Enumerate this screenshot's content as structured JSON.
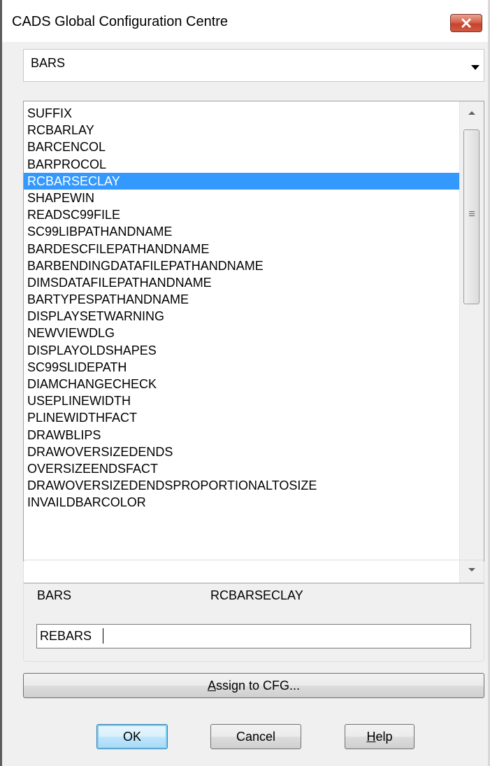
{
  "window": {
    "title": "CADS Global Configuration Centre"
  },
  "combo": {
    "value": "BARS"
  },
  "list": {
    "items": [
      "SUFFIX",
      "RCBARLAY",
      "BARCENCOL",
      "BARPROCOL",
      "RCBARSECLAY",
      "SHAPEWIN",
      "READSC99FILE",
      "SC99LIBPATHANDNAME",
      "BARDESCFILEPATHANDNAME",
      "BARBENDINGDATAFILEPATHANDNAME",
      "DIMSDATAFILEPATHANDNAME",
      "BARTYPESPATHANDNAME",
      "DISPLAYSETWARNING",
      "NEWVIEWDLG",
      "DISPLAYOLDSHAPES",
      "SC99SLIDEPATH",
      "DIAMCHANGECHECK",
      "USEPLINEWIDTH",
      "PLINEWIDTHFACT",
      "DRAWBLIPS",
      "DRAWOVERSIZEDENDS",
      "OVERSIZEENDSFACT",
      "DRAWOVERSIZEDENDSPROPORTIONALTOSIZE",
      "INVAILDBARCOLOR"
    ],
    "selected_index": 4
  },
  "detail": {
    "section": "BARS",
    "key": "RCBARSECLAY",
    "value": "REBARS"
  },
  "buttons": {
    "assign_pre": "",
    "assign_mnemonic": "A",
    "assign_post": "ssign to CFG...",
    "ok": "OK",
    "cancel": "Cancel",
    "help_mnemonic": "H",
    "help_post": "elp"
  },
  "colors": {
    "selection": "#3399ff",
    "close_button": "#c4432d",
    "default_button_border": "#3c7fb1"
  }
}
